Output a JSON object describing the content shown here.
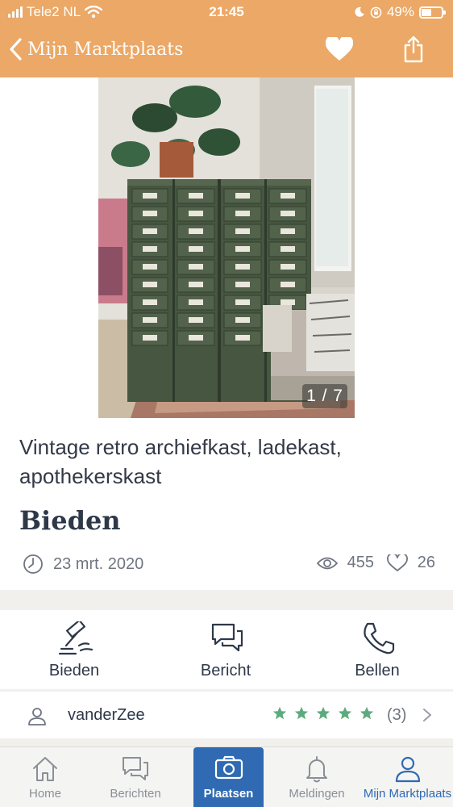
{
  "status_bar": {
    "carrier": "Tele2 NL",
    "time": "21:45",
    "battery_percent": "49%",
    "battery_level": 0.49
  },
  "nav": {
    "back_label": "Mijn Marktplaats",
    "icons": [
      "chevron-left-icon",
      "heart-icon",
      "share-icon"
    ]
  },
  "listing": {
    "photo_counter": "1 / 7",
    "title": "Vintage retro archiefkast, ladekast, apothekerskast",
    "price": "Bieden",
    "date": "23 mrt. 2020",
    "views": "455",
    "favorites": "26"
  },
  "actions": [
    {
      "label": "Bieden",
      "icon": "gavel-icon"
    },
    {
      "label": "Bericht",
      "icon": "chat-icon"
    },
    {
      "label": "Bellen",
      "icon": "phone-icon"
    }
  ],
  "seller": {
    "name": "vanderZee",
    "rating_count": "(3)",
    "stars": 5
  },
  "tabs": [
    {
      "label": "Home",
      "icon": "home-icon"
    },
    {
      "label": "Berichten",
      "icon": "chat-icon"
    },
    {
      "label": "Plaatsen",
      "icon": "camera-icon"
    },
    {
      "label": "Meldingen",
      "icon": "bell-icon"
    },
    {
      "label": "Mijn Marktplaats",
      "icon": "user-icon"
    }
  ],
  "colors": {
    "header": "#eba866",
    "primary_blue": "#2f6ab2",
    "star_green": "#5cab7d",
    "text": "#2e3849"
  }
}
